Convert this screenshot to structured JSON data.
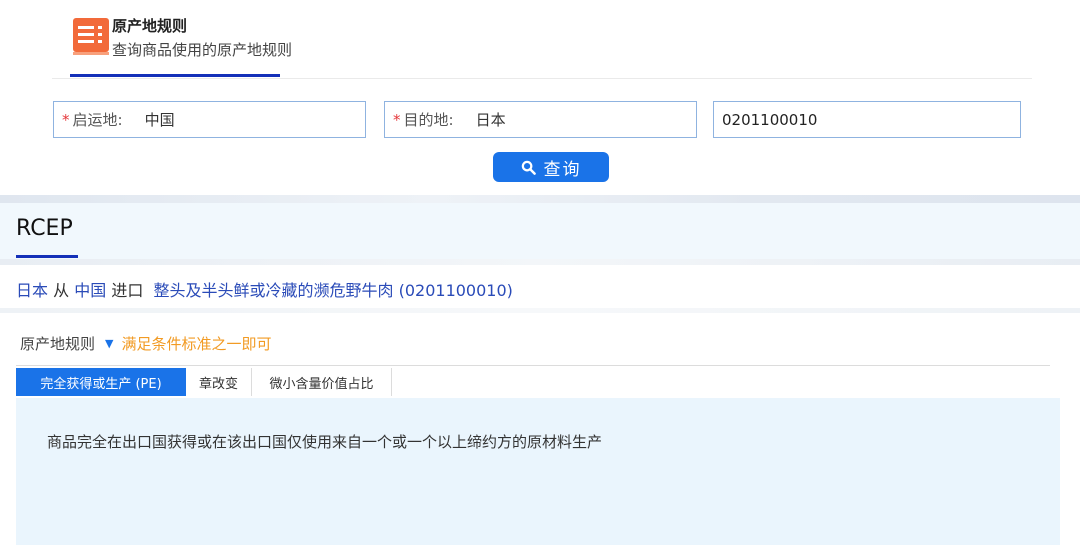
{
  "header": {
    "title": "原产地规则",
    "subtitle": "查询商品使用的原产地规则",
    "logo_icon": "book-icon",
    "accent_color": "#1430b8",
    "logo_color": "#f26a3a"
  },
  "search": {
    "origin": {
      "required_mark": "*",
      "label": "启运地:",
      "value": "中国"
    },
    "destination": {
      "required_mark": "*",
      "label": "目的地:",
      "value": "日本"
    },
    "hs_code": {
      "value": "0201100010"
    },
    "button_label": "查询",
    "button_icon": "search-icon",
    "button_color": "#1a73e8"
  },
  "agreement": {
    "name": "RCEP"
  },
  "route": {
    "destination": "日本",
    "from_word": "从",
    "origin": "中国",
    "import_word": "进口",
    "product": "整头及半头鲜或冷藏的濒危野牛肉 (0201100010)"
  },
  "rules": {
    "label": "原产地规则",
    "note": "满足条件标准之一即可",
    "note_color": "#f29b24",
    "tabs": [
      {
        "label": "完全获得或生产 (PE)",
        "active": true
      },
      {
        "label": "章改变",
        "active": false
      },
      {
        "label": "微小含量价值占比",
        "active": false
      }
    ],
    "content": "商品完全在出口国获得或在该出口国仅使用来自一个或一个以上缔约方的原材料生产"
  }
}
